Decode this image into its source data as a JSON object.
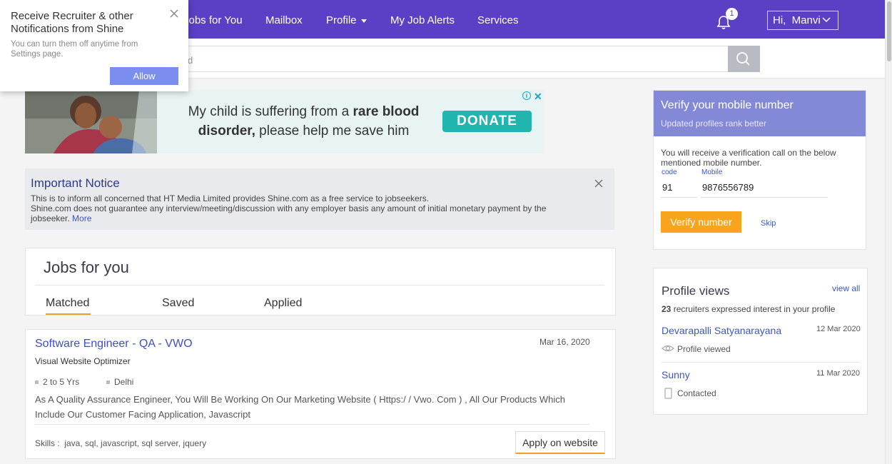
{
  "nav": {
    "items": [
      "Jobs for You",
      "Mailbox",
      "Profile",
      "My Job Alerts",
      "Services"
    ],
    "notification_count": "1",
    "user_greeting": "Hi,  Manvi"
  },
  "search": {
    "placeholder": "d"
  },
  "notification_popup": {
    "title": "Receive Recruiter & other Notifications from Shine",
    "subtitle": "You can turn them off anytime from Settings page.",
    "allow_label": "Allow"
  },
  "ad": {
    "text_part1": "My child is suffering from a ",
    "text_bold": "rare blood disorder,",
    "text_part2": " please help me save him",
    "donate_label": "DONATE",
    "info_label": "i",
    "close_label": "✕"
  },
  "notice": {
    "title": "Important Notice",
    "line1": "This is to inform all concerned that HT Media Limited provides Shine.com as a free service to jobseekers.",
    "line2": "Shine.com does not guarantee any interview/meeting/discussion with any employer basis any amount of initial monetary payment by the jobseeker. ",
    "more_label": "More"
  },
  "jobs_section": {
    "title": "Jobs for you",
    "tabs": [
      "Matched",
      "Saved",
      "Applied"
    ]
  },
  "job": {
    "title": "Software Engineer - QA - VWO",
    "date": "Mar 16, 2020",
    "company": "Visual Website Optimizer",
    "experience": "2 to 5 Yrs",
    "location": "Delhi",
    "description": "As A Quality Assurance Engineer, You Will Be Working On Our Marketing Website ( Https:/ / Vwo. Com ) , All Our Products Which Include Our Customer Facing Application, Javascript",
    "skills": "Skills :  java, sql, javascript, sql server, jquery",
    "apply_label": "Apply on website"
  },
  "verify": {
    "title": "Verify your mobile number",
    "subtitle": "Updated profiles rank better",
    "text": "You will receive a verification call on the below mentioned mobile number.",
    "code_label": "code",
    "code_value": "91",
    "mobile_label": "Mobile",
    "mobile_value": "9876556789",
    "verify_label": "Verify number",
    "skip_label": "Skip"
  },
  "profile_views": {
    "title": "Profile views",
    "view_all": "view all",
    "count": "23",
    "count_text": " recruiters expressed interest in your profile",
    "viewers": [
      {
        "name": "Devarapalli Satyanarayana",
        "date": "12 Mar 2020",
        "status": "Profile viewed",
        "icon": "eye-icon"
      },
      {
        "name": "Sunny",
        "date": "11 Mar 2020",
        "status": "Contacted",
        "icon": "mobile-icon"
      }
    ]
  },
  "colors": {
    "brand_purple": "#5b3fc4",
    "link_blue": "#3d4ec8",
    "accent_orange": "#f8a41c",
    "verify_header": "#8389d6",
    "donate_teal": "#21b5b0"
  }
}
